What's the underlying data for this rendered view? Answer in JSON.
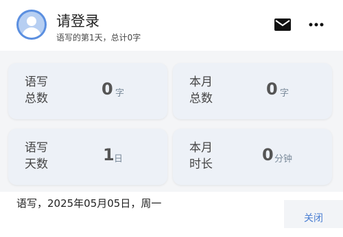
{
  "header": {
    "title": "请登录",
    "subtitle": "语写的第1天，总计0字"
  },
  "stats": [
    {
      "label_line1": "语写",
      "label_line2": "总数",
      "value": "0",
      "unit": "字"
    },
    {
      "label_line1": "本月",
      "label_line2": "总数",
      "value": "0",
      "unit": "字"
    },
    {
      "label_line1": "语写",
      "label_line2": "天数",
      "value": "1",
      "unit": "日"
    },
    {
      "label_line1": "本月",
      "label_line2": "时长",
      "value": "0",
      "unit": "分钟"
    }
  ],
  "footer": {
    "date": "语写，2025年05月05日，周一",
    "close_label": "关闭"
  },
  "icons": {
    "avatar": "user-avatar-icon",
    "mail": "mail-icon",
    "more": "more-icon"
  },
  "colors": {
    "accent": "#4a7ed2",
    "avatar": "#5b8fe0"
  }
}
